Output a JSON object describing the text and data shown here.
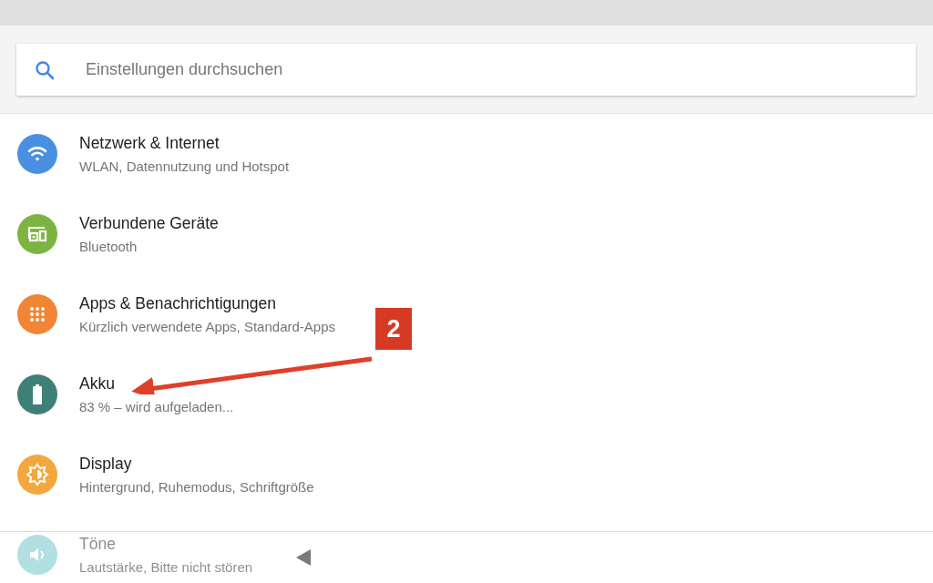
{
  "search": {
    "placeholder": "Einstellungen durchsuchen"
  },
  "items": [
    {
      "kind": "network",
      "faded": false,
      "color": "#4a90e2",
      "title": "Netzwerk & Internet",
      "subtitle": "WLAN, Datennutzung und Hotspot"
    },
    {
      "kind": "devices",
      "faded": false,
      "color": "#7cb342",
      "title": "Verbundene Geräte",
      "subtitle": "Bluetooth"
    },
    {
      "kind": "apps",
      "faded": false,
      "color": "#ef8535",
      "title": "Apps & Benachrichtigungen",
      "subtitle": "Kürzlich verwendete Apps, Standard-Apps"
    },
    {
      "kind": "battery",
      "faded": false,
      "color": "#3e8077",
      "title": "Akku",
      "subtitle": "83 % – wird aufgeladen..."
    },
    {
      "kind": "display",
      "faded": false,
      "color": "#f2a73f",
      "title": "Display",
      "subtitle": "Hintergrund, Ruhemodus, Schriftgröße"
    },
    {
      "kind": "sound",
      "faded": true,
      "color": "#b2dfe2",
      "title": "Töne",
      "subtitle": "Lautstärke, Bitte nicht stören"
    }
  ],
  "annotation": {
    "label": "2"
  }
}
